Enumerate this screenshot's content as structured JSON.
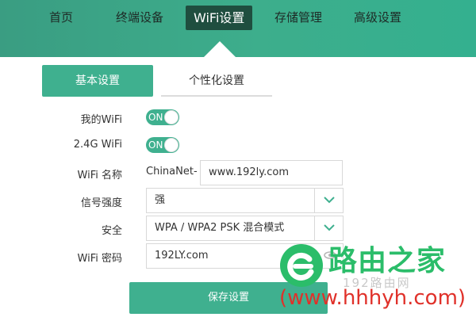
{
  "nav": {
    "items": [
      "首页",
      "终端设备",
      "WiFi设置",
      "存储管理",
      "高级设置"
    ],
    "active": "WiFi设置"
  },
  "subtabs": {
    "basic": "基本设置",
    "personal": "个性化设置"
  },
  "form": {
    "my_wifi_label": "我的WiFi",
    "my_wifi_toggle": "ON",
    "wifi24_label": "2.4G WiFi",
    "wifi24_toggle": "ON",
    "wifi_name_label": "WiFi 名称",
    "wifi_name_prefix": "ChinaNet-",
    "wifi_name_value": "www.192ly.com",
    "signal_label": "信号强度",
    "signal_value": "强",
    "security_label": "安全",
    "security_value": "WPA / WPA2 PSK 混合模式",
    "password_label": "WiFi 密码",
    "password_value": "192LY.com"
  },
  "actions": {
    "save_label": "保存设置"
  },
  "watermark": {
    "title": "路由之家",
    "sub": "192路由网",
    "url": "(www.hhhyh.com)"
  },
  "colors": {
    "accent": "#3fb08f",
    "nav_active": "#1f4e3f",
    "watermark_green": "#2bbd6a",
    "watermark_red": "#e0312a"
  }
}
